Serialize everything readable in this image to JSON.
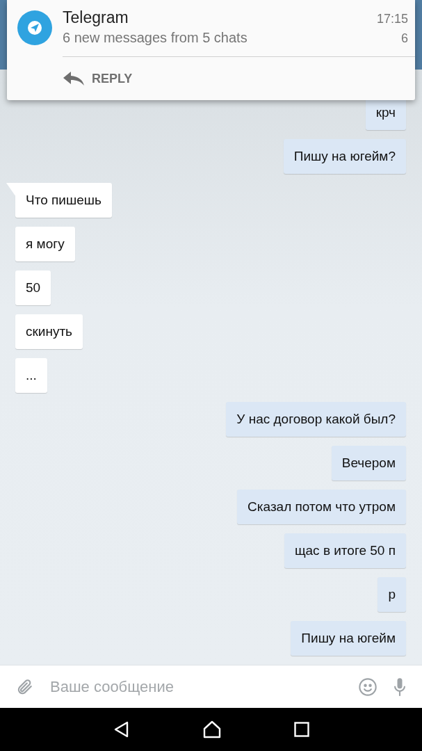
{
  "notification": {
    "app": "Telegram",
    "time": "17:15",
    "summary": "6 new messages from 5 chats",
    "count": "6",
    "action": "REPLY"
  },
  "messages": [
    {
      "kind": "sent",
      "text": "крч",
      "tail": false
    },
    {
      "kind": "sent",
      "text": "Пишу на югейм?",
      "tail": false
    },
    {
      "kind": "received",
      "text": "Что пишешь",
      "tail": true
    },
    {
      "kind": "received",
      "text": "я могу",
      "tail": false
    },
    {
      "kind": "received",
      "text": "50",
      "tail": false
    },
    {
      "kind": "received",
      "text": "скинуть",
      "tail": false
    },
    {
      "kind": "received",
      "text": "...",
      "tail": false
    },
    {
      "kind": "sent",
      "text": "У нас договор какой был?",
      "tail": false
    },
    {
      "kind": "sent",
      "text": "Вечером",
      "tail": false
    },
    {
      "kind": "sent",
      "text": "Сказал потом что утром",
      "tail": false
    },
    {
      "kind": "sent",
      "text": "щас в итоге 50 п",
      "tail": false
    },
    {
      "kind": "sent",
      "text": "р",
      "tail": false
    },
    {
      "kind": "sent",
      "text": "Пишу на югейм",
      "tail": false
    }
  ],
  "composer": {
    "placeholder": "Ваше сообщение"
  }
}
